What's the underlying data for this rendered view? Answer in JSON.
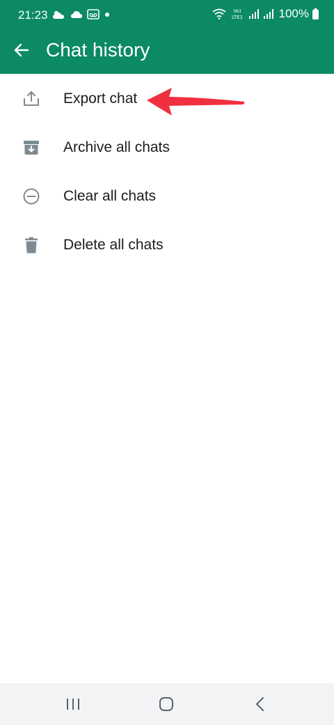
{
  "status_bar": {
    "time": "21:23",
    "battery": "100%",
    "network_label": "Vo) LTE1"
  },
  "toolbar": {
    "title": "Chat history",
    "back_icon": "arrow-left-icon"
  },
  "menu": {
    "items": [
      {
        "label": "Export chat",
        "icon": "export-icon"
      },
      {
        "label": "Archive all chats",
        "icon": "archive-icon"
      },
      {
        "label": "Clear all chats",
        "icon": "minus-circle-icon"
      },
      {
        "label": "Delete all chats",
        "icon": "trash-icon"
      }
    ]
  },
  "nav_bar": {
    "buttons": [
      "recent-apps-icon",
      "home-icon",
      "back-icon"
    ]
  },
  "colors": {
    "appbar": "#0b8a63",
    "icon_gray": "#7d8a91",
    "annotation_red": "#f0303f",
    "nav_bg": "#f2f3f5"
  }
}
